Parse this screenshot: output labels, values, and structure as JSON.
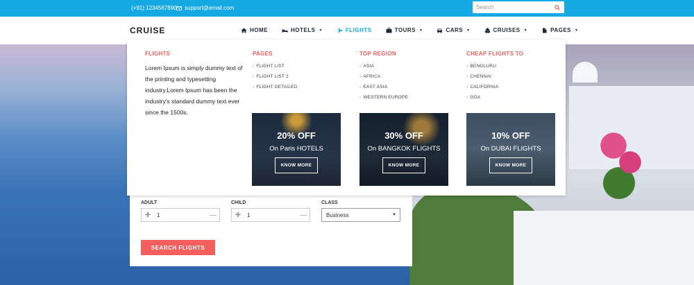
{
  "topbar": {
    "phone": "(+91) 1234567890",
    "email": "support@email.com",
    "search_placeholder": "Search"
  },
  "navbar": {
    "logo": "CRUISE",
    "items": [
      {
        "label": "HOME",
        "icon": "home-icon",
        "caret": false
      },
      {
        "label": "HOTELS",
        "icon": "bed-icon",
        "caret": true
      },
      {
        "label": "FLIGHTS",
        "icon": "plane-icon",
        "caret": false,
        "active": true
      },
      {
        "label": "TOURS",
        "icon": "suitcase-icon",
        "caret": true
      },
      {
        "label": "CARS",
        "icon": "car-icon",
        "caret": true
      },
      {
        "label": "CRUISES",
        "icon": "ship-icon",
        "caret": true
      },
      {
        "label": "PAGES",
        "icon": "file-icon",
        "caret": true
      }
    ]
  },
  "mega": {
    "flights": {
      "heading": "FLIGHTS",
      "description": "Lorem Ipsum is simply dummy text of the printing and typesetting industry.Lorem Ipsum has been the industry's standard dummy text ever since the 1500s."
    },
    "pages": {
      "heading": "PAGES",
      "links": [
        "FLIGHT LIST",
        "FLIGHT LIST 2",
        "FLIGHT DETAILED"
      ]
    },
    "top_region": {
      "heading": "TOP REGION",
      "links": [
        "ASIA",
        "AFRICA",
        "EAST ASIA",
        "WESTERN EUROPE"
      ]
    },
    "cheap_flights": {
      "heading": "CHEAP FLIGHTS TO",
      "links": [
        "BENGLURU",
        "CHENNAI",
        "CALIFORNIA",
        "GOA"
      ]
    },
    "promos": [
      {
        "discount": "20% OFF",
        "text": "On Paris HOTELS",
        "button": "KNOW MORE"
      },
      {
        "discount": "30% OFF",
        "text": "On BANGKOK FLIGHTS",
        "button": "KNOW MORE"
      },
      {
        "discount": "10% OFF",
        "text": "On DUBAI FLIGHTS",
        "button": "KNOW MORE"
      }
    ]
  },
  "form": {
    "adult_label": "ADULT",
    "adult_value": "1",
    "child_label": "CHILD",
    "child_value": "1",
    "class_label": "CLASS",
    "class_value": "Business",
    "submit_label": "SEARCH FLIGHTS"
  },
  "colors": {
    "accent_blue": "#16a9e6",
    "accent_red": "#f25f5c"
  }
}
